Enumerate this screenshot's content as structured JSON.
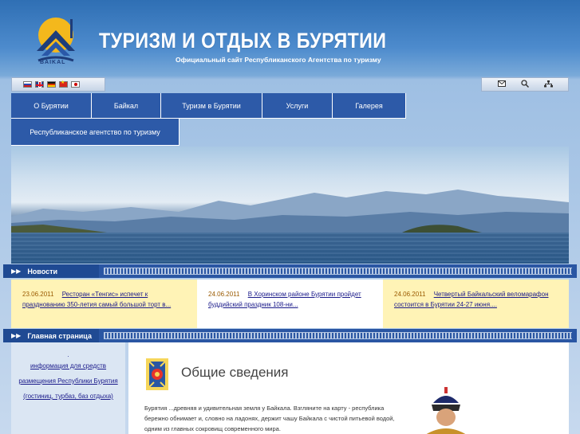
{
  "header": {
    "logo_text": "BAIKAL",
    "title": "ТУРИЗМ И ОТДЫХ В БУРЯТИИ",
    "subtitle": "Официальный сайт Республиканского Агентства по туризму"
  },
  "languages": [
    {
      "code": "ru",
      "icon": "flag-ru-icon"
    },
    {
      "code": "en",
      "icon": "flag-en-icon"
    },
    {
      "code": "de",
      "icon": "flag-de-icon"
    },
    {
      "code": "cn",
      "icon": "flag-cn-icon"
    },
    {
      "code": "jp",
      "icon": "flag-jp-icon"
    }
  ],
  "tools": [
    {
      "icon": "mail-icon",
      "glyph": "✉"
    },
    {
      "icon": "search-icon",
      "glyph": "🔍"
    },
    {
      "icon": "sitemap-icon",
      "glyph": "⌂"
    }
  ],
  "nav": {
    "row1": [
      "О Бурятии",
      "Байкал",
      "Туризм в Бурятии",
      "Услуги",
      "Галерея"
    ],
    "row2": [
      "Республиканское агентство по туризму"
    ]
  },
  "news_strip": {
    "title": "Новости"
  },
  "news": [
    {
      "date": "23.06.2011",
      "text": "Ресторан «Тенгис» испечет к празднованию 350-летия самый большой торт в..."
    },
    {
      "date": "24.06.2011",
      "text": "В Хоринском районе Бурятии пройдет буддийский праздник 108-ни..."
    },
    {
      "date": "24.06.2011",
      "text": "Четвертый Байкальский веломарафон состоится в Бурятии 24-27 июня...."
    }
  ],
  "main_strip": {
    "title": "Главная страница"
  },
  "sidebar": {
    "dot": ".",
    "links": [
      "информация для средств",
      "размещения Республики Бурятия",
      "(гостиниц, турбаз, баз отдыха)"
    ]
  },
  "content": {
    "title": "Общие сведения",
    "text": "Бурятия ...древняя и удивительная земля у Байкала. Взгляните на карту - республика бережно обнимает и, словно на ладонях, держит чашу Байкала с чистой питьевой водой, одним из главных сокровищ современного мира."
  },
  "colors": {
    "nav_bg": "#2d5aa8",
    "strip_bg": "#2a56a3",
    "news_odd": "#fff3b6",
    "sidebar_bg": "#dbe6f3"
  }
}
